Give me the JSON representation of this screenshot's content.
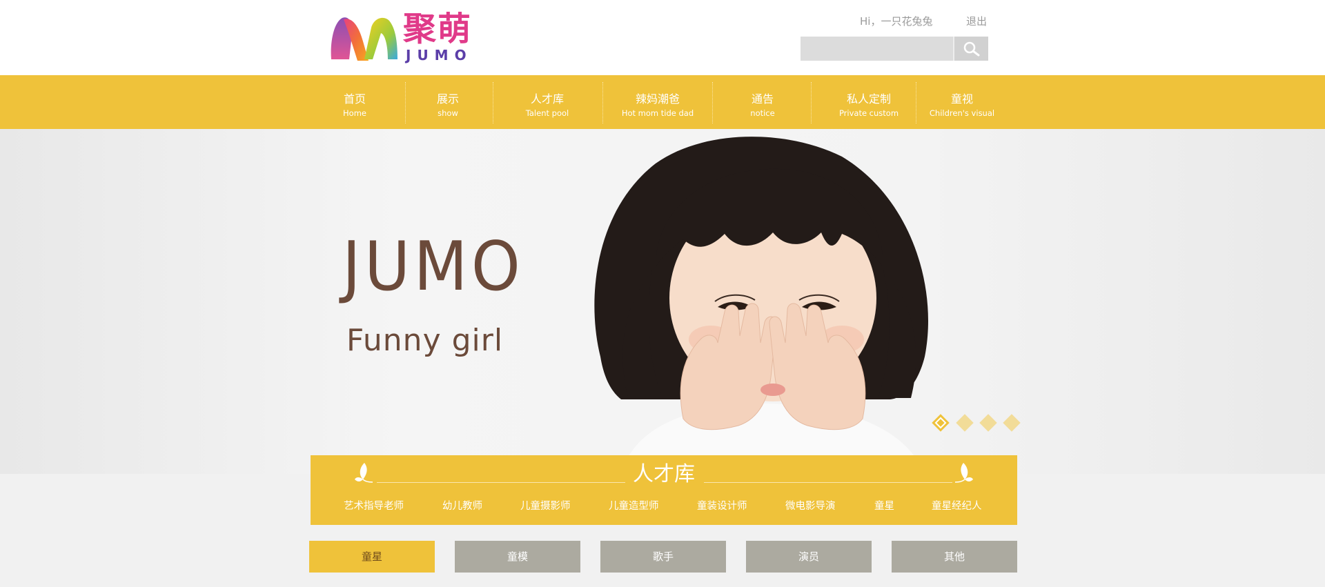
{
  "header": {
    "logo": {
      "cn": "聚萌",
      "en": "JUMO"
    },
    "greeting": "Hi，一只花兔兔",
    "logout": "退出",
    "search": {
      "placeholder": "",
      "button_icon": "search-icon"
    }
  },
  "nav": {
    "items": [
      {
        "cn": "首页",
        "en": "Home"
      },
      {
        "cn": "展示",
        "en": "show"
      },
      {
        "cn": "人才库",
        "en": "Talent pool"
      },
      {
        "cn": "辣妈潮爸",
        "en": "Hot mom tide dad"
      },
      {
        "cn": "通告",
        "en": "notice"
      },
      {
        "cn": "私人定制",
        "en": "Private custom"
      },
      {
        "cn": "童视",
        "en": "Children's visual"
      }
    ]
  },
  "hero": {
    "title": "JUMO",
    "subtitle": "Funny girl",
    "slides": 4,
    "active_slide": 1
  },
  "talent": {
    "title": "人才库",
    "categories": [
      "艺术指导老师",
      "幼儿教师",
      "儿童摄影师",
      "儿童造型师",
      "童装设计师",
      "微电影导演",
      "童星",
      "童星经纪人"
    ]
  },
  "filters": {
    "tabs": [
      "童星",
      "童模",
      "歌手",
      "演员",
      "其他"
    ],
    "active": 0
  },
  "colors": {
    "accent": "#efc23a",
    "tab_inactive": "#acaaa0",
    "hero_text": "#6b4a3a",
    "logo_pink": "#e03a89",
    "logo_purple": "#5b3ea8"
  }
}
